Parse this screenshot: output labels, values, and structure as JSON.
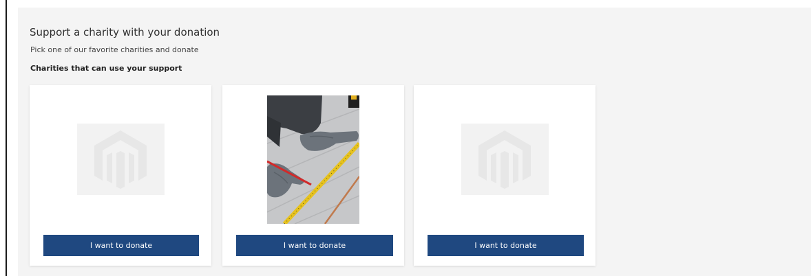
{
  "donation": {
    "title": "Support a charity with your donation",
    "subtitle": "Pick one of our favorite charities and donate",
    "section_heading": "Charities that can use your support",
    "charities": [
      {
        "image": "magento-logo-placeholder",
        "button_label": "I want to donate"
      },
      {
        "image": "photo-gloved-hands-measuring-floor-with-tape-measure",
        "button_label": "I want to donate"
      },
      {
        "image": "magento-logo-placeholder",
        "button_label": "I want to donate"
      }
    ]
  },
  "colors": {
    "panel_background": "#f4f4f4",
    "card_background": "#ffffff",
    "button_background": "#1f4880",
    "button_text": "#ffffff"
  }
}
